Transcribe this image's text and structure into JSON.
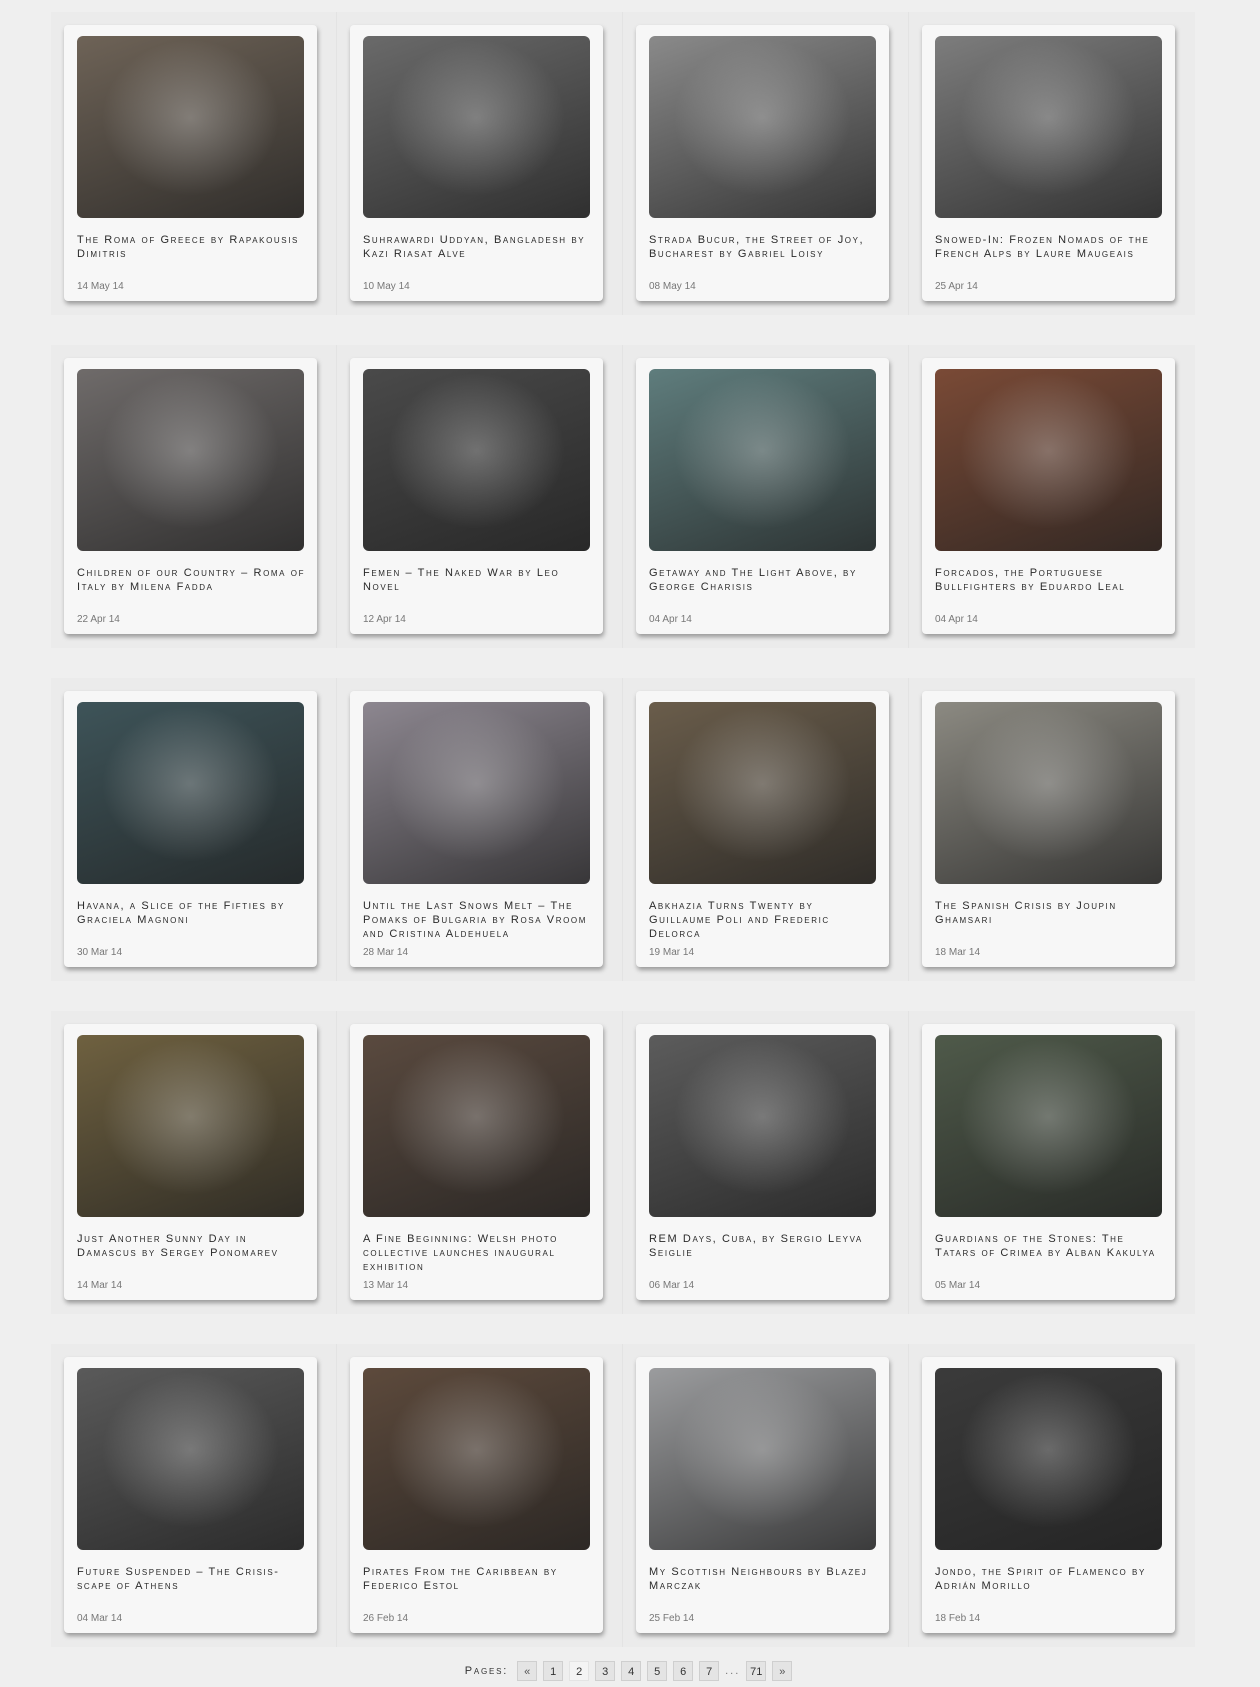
{
  "colors": {
    "page_bg": "#efefef",
    "row_bg": "#ebebeb",
    "card_bg": "#f7f7f7",
    "text": "#2a2a2a",
    "date_text": "#777777"
  },
  "posts": [
    {
      "title": "The Roma of Greece by Rapakousis Dimitris",
      "date": "14 May 14",
      "image": "photo-child-portrait",
      "tone": "#6e6357"
    },
    {
      "title": "Suhrawardi Uddyan, Bangladesh by Kazi Riasat Alve",
      "date": "10 May 14",
      "image": "photo-sleeping-family",
      "tone": "#6a6a6a"
    },
    {
      "title": "Strada Bucur, the Street of Joy, Bucharest by Gabriel Loisy",
      "date": "08 May 14",
      "image": "photo-hands-over-face",
      "tone": "#8a8a8a"
    },
    {
      "title": "Snowed-In: Frozen Nomads of the French Alps by Laure Maugeais",
      "date": "25 Apr 14",
      "image": "photo-dreamcatcher-tattoo",
      "tone": "#7d7d7d"
    },
    {
      "title": "Children of our Country – Roma of Italy by Milena Fadda",
      "date": "22 Apr 14",
      "image": "photo-woman-earring",
      "tone": "#6f6b6a"
    },
    {
      "title": "Femen – The Naked War by Leo Novel",
      "date": "12 Apr 14",
      "image": "photo-protest-arrest",
      "tone": "#4a4a4a"
    },
    {
      "title": "Getaway and The Light Above, by George Charisis",
      "date": "04 Apr 14",
      "image": "photo-woman-in-water",
      "tone": "#5f7d7d"
    },
    {
      "title": "Forcados, the Portuguese Bullfighters by Eduardo Leal",
      "date": "04 Apr 14",
      "image": "photo-bullfighter",
      "tone": "#7a4a36"
    },
    {
      "title": "Havana, a Slice of the Fifties by Graciela Magnoni",
      "date": "30 Mar 14",
      "image": "photo-portrait-wall",
      "tone": "#3e5459"
    },
    {
      "title": "Until the Last Snows Melt – The Pomaks of Bulgaria by Rosa Vroom and Cristina Aldehuela",
      "date": "28 Mar 14",
      "image": "photo-outdoor-bed",
      "tone": "#8d8790"
    },
    {
      "title": "Abkhazia Turns Twenty by Guillaume Poli and Frederic Delorca",
      "date": "19 Mar 14",
      "image": "photo-crowd-flags",
      "tone": "#6a5d4b"
    },
    {
      "title": "The Spanish Crisis by Joupin Ghamsari",
      "date": "18 Mar 14",
      "image": "photo-empty-stadium",
      "tone": "#8c8a82"
    },
    {
      "title": "Just Another Sunny Day in Damascus by Sergey Ponomarev",
      "date": "14 Mar 14",
      "image": "photo-bowed-man",
      "tone": "#6f6140"
    },
    {
      "title": "A Fine Beginning: Welsh photo collective launches inaugural exhibition",
      "date": "13 Mar 14",
      "image": "photo-redhead-car",
      "tone": "#5a4a3f"
    },
    {
      "title": "REM Days, Cuba, by Sergio Leyva Seiglie",
      "date": "06 Mar 14",
      "image": "photo-armed-group",
      "tone": "#5c5c5c"
    },
    {
      "title": "Guardians of the Stones: The Tatars of Crimea by Alban Kakulya",
      "date": "05 Mar 14",
      "image": "photo-red-flag",
      "tone": "#4f5a4a"
    },
    {
      "title": "Future Suspended – The Crisis-scape of Athens",
      "date": "04 Mar 14",
      "image": "photo-raised-hands",
      "tone": "#5a5a5a"
    },
    {
      "title": "Pirates From the Caribbean by Federico Estol",
      "date": "26 Feb 14",
      "image": "photo-pirate-bar",
      "tone": "#5d4a3c"
    },
    {
      "title": "My Scottish Neighbours by Blazej Marczak",
      "date": "25 Feb 14",
      "image": "photo-couple-sofa",
      "tone": "#9b9c9e"
    },
    {
      "title": "Jondo, the Spirit of Flamenco by Adrián Morillo",
      "date": "18 Feb 14",
      "image": "photo-flamenco-man",
      "tone": "#3b3b3b"
    }
  ],
  "pagination": {
    "label": "Pages:",
    "prev": "«",
    "pages": [
      "1",
      "2",
      "3",
      "4",
      "5",
      "6",
      "7"
    ],
    "current": "2",
    "ellipsis": "...",
    "last": "71",
    "next": "»"
  }
}
